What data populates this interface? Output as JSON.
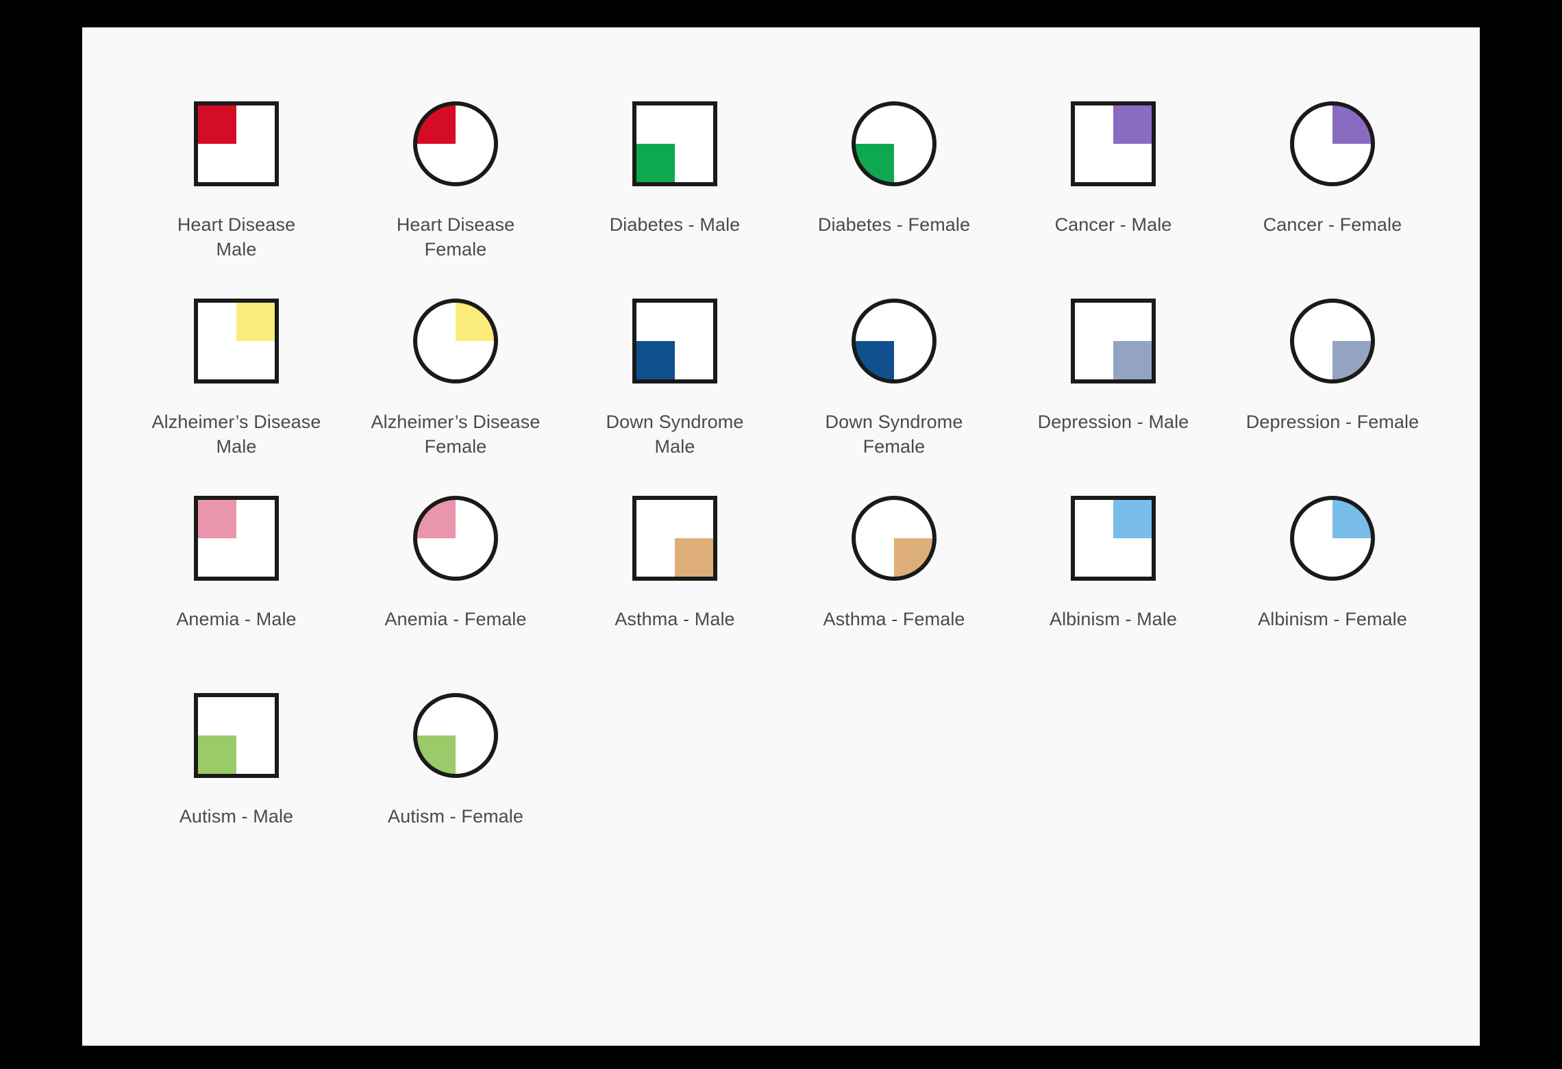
{
  "card": {
    "background_color": "#f9f9f9",
    "page_background_color": "#000000"
  },
  "legend_colors": {
    "heart_disease": "#D50D24",
    "diabetes": "#0DA84F",
    "cancer": "#8B6BC1",
    "alzheimers_disease": "#FBEB7A",
    "down_syndrome": "#11508F",
    "depression": "#93A4C2",
    "anemia": "#E995AC",
    "asthma": "#DDAE78",
    "albinism": "#79BDEA",
    "autism": "#9BCA68",
    "outline": "#1a1a1a",
    "shape_fill": "#ffffff",
    "label_text": "#4a4a4a"
  },
  "chart_data": {
    "type": "table",
    "title": "",
    "description": "Grid of pedigree-style condition icons: squares denote Male, circles denote Female; each icon has one colored quadrant indicating the condition.",
    "columns": 6,
    "rows": 4,
    "shape_legend": {
      "square": "Male",
      "circle": "Female"
    },
    "quadrant_legend": {
      "nw": "top-left",
      "ne": "top-right",
      "sw": "bottom-left",
      "se": "bottom-right"
    },
    "items": [
      {
        "label": "Heart Disease\nMale",
        "condition": "Heart Disease",
        "sex": "Male",
        "shape": "square",
        "quadrant": "nw",
        "color": "#D50D24"
      },
      {
        "label": "Heart Disease\nFemale",
        "condition": "Heart Disease",
        "sex": "Female",
        "shape": "circle",
        "quadrant": "nw",
        "color": "#D50D24"
      },
      {
        "label": "Diabetes - Male",
        "condition": "Diabetes",
        "sex": "Male",
        "shape": "square",
        "quadrant": "sw",
        "color": "#0DA84F"
      },
      {
        "label": "Diabetes - Female",
        "condition": "Diabetes",
        "sex": "Female",
        "shape": "circle",
        "quadrant": "sw",
        "color": "#0DA84F"
      },
      {
        "label": "Cancer - Male",
        "condition": "Cancer",
        "sex": "Male",
        "shape": "square",
        "quadrant": "ne",
        "color": "#8B6BC1"
      },
      {
        "label": "Cancer - Female",
        "condition": "Cancer",
        "sex": "Female",
        "shape": "circle",
        "quadrant": "ne",
        "color": "#8B6BC1"
      },
      {
        "label": "Alzheimer’s Disease\nMale",
        "condition": "Alzheimer’s Disease",
        "sex": "Male",
        "shape": "square",
        "quadrant": "ne",
        "color": "#FBEB7A"
      },
      {
        "label": "Alzheimer’s Disease\nFemale",
        "condition": "Alzheimer’s Disease",
        "sex": "Female",
        "shape": "circle",
        "quadrant": "ne",
        "color": "#FBEB7A"
      },
      {
        "label": "Down Syndrome\nMale",
        "condition": "Down Syndrome",
        "sex": "Male",
        "shape": "square",
        "quadrant": "sw",
        "color": "#11508F"
      },
      {
        "label": "Down Syndrome\nFemale",
        "condition": "Down Syndrome",
        "sex": "Female",
        "shape": "circle",
        "quadrant": "sw",
        "color": "#11508F"
      },
      {
        "label": "Depression - Male",
        "condition": "Depression",
        "sex": "Male",
        "shape": "square",
        "quadrant": "se",
        "color": "#93A4C2"
      },
      {
        "label": "Depression - Female",
        "condition": "Depression",
        "sex": "Female",
        "shape": "circle",
        "quadrant": "se",
        "color": "#93A4C2"
      },
      {
        "label": "Anemia - Male",
        "condition": "Anemia",
        "sex": "Male",
        "shape": "square",
        "quadrant": "nw",
        "color": "#E995AC"
      },
      {
        "label": "Anemia - Female",
        "condition": "Anemia",
        "sex": "Female",
        "shape": "circle",
        "quadrant": "nw",
        "color": "#E995AC"
      },
      {
        "label": "Asthma - Male",
        "condition": "Asthma",
        "sex": "Male",
        "shape": "square",
        "quadrant": "se",
        "color": "#DDAE78"
      },
      {
        "label": "Asthma - Female",
        "condition": "Asthma",
        "sex": "Female",
        "shape": "circle",
        "quadrant": "se",
        "color": "#DDAE78"
      },
      {
        "label": "Albinism - Male",
        "condition": "Albinism",
        "sex": "Male",
        "shape": "square",
        "quadrant": "ne",
        "color": "#79BDEA"
      },
      {
        "label": "Albinism - Female",
        "condition": "Albinism",
        "sex": "Female",
        "shape": "circle",
        "quadrant": "ne",
        "color": "#79BDEA"
      },
      {
        "label": "Autism - Male",
        "condition": "Autism",
        "sex": "Male",
        "shape": "square",
        "quadrant": "sw",
        "color": "#9BCA68"
      },
      {
        "label": "Autism - Female",
        "condition": "Autism",
        "sex": "Female",
        "shape": "circle",
        "quadrant": "sw",
        "color": "#9BCA68"
      }
    ]
  }
}
